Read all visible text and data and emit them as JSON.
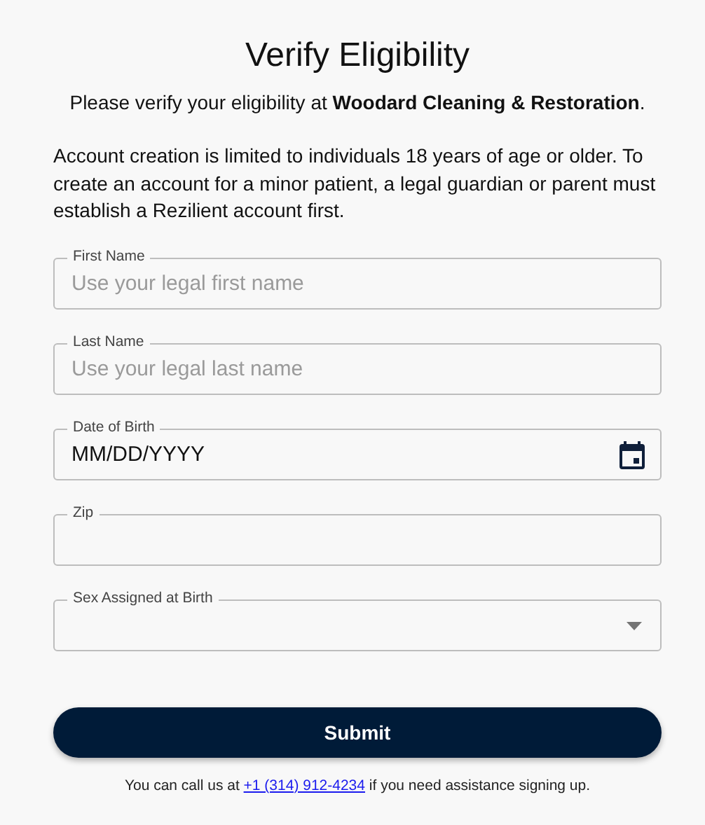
{
  "title": "Verify Eligibility",
  "subtitle": "Please verify your eligibility at **Woodard Cleaning & Restoration**.",
  "notice": "Account creation is limited to individuals 18 years of age or older. To create an account for a minor patient, a legal guardian or parent must establish a Rezilient account first.",
  "fields": [
    {
      "kind": "text",
      "label": "First Name",
      "placeholder": "Use your legal first name"
    },
    {
      "kind": "text",
      "label": "Last Name",
      "placeholder": "Use your legal last name"
    },
    {
      "kind": "date",
      "label": "Date of Birth",
      "value": "MM/DD/YYYY"
    },
    {
      "kind": "text",
      "label": "Zip"
    },
    {
      "kind": "select",
      "label": "Sex Assigned at Birth"
    }
  ],
  "submit": "Submit",
  "footer": {
    "before": "You can call us at",
    "link": "+1 (314) 912-4234",
    "after": "if you need assistance signing up."
  }
}
